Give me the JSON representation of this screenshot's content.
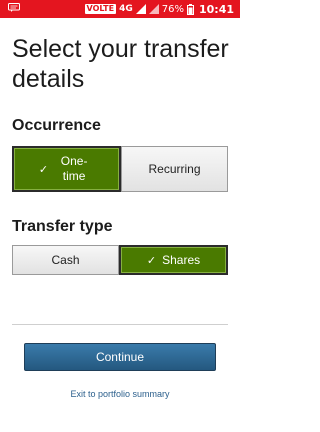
{
  "status_bar": {
    "network_badge": "VOLTE",
    "network_type": "4G",
    "battery": "76%",
    "time": "10:41"
  },
  "page": {
    "title": "Select your transfer details"
  },
  "occurrence": {
    "label": "Occurrence",
    "options": [
      {
        "label": "One-time",
        "selected": true
      },
      {
        "label": "Recurring",
        "selected": false
      }
    ]
  },
  "transfer_type": {
    "label": "Transfer type",
    "options": [
      {
        "label": "Cash",
        "selected": false
      },
      {
        "label": "Shares",
        "selected": true
      }
    ]
  },
  "actions": {
    "continue_label": "Continue",
    "exit_label": "Exit to portfolio summary"
  },
  "colors": {
    "status_bar": "#e4151f",
    "selected": "#4a7a00",
    "primary_button": "#2f6a96",
    "link": "#2b5f8c"
  }
}
